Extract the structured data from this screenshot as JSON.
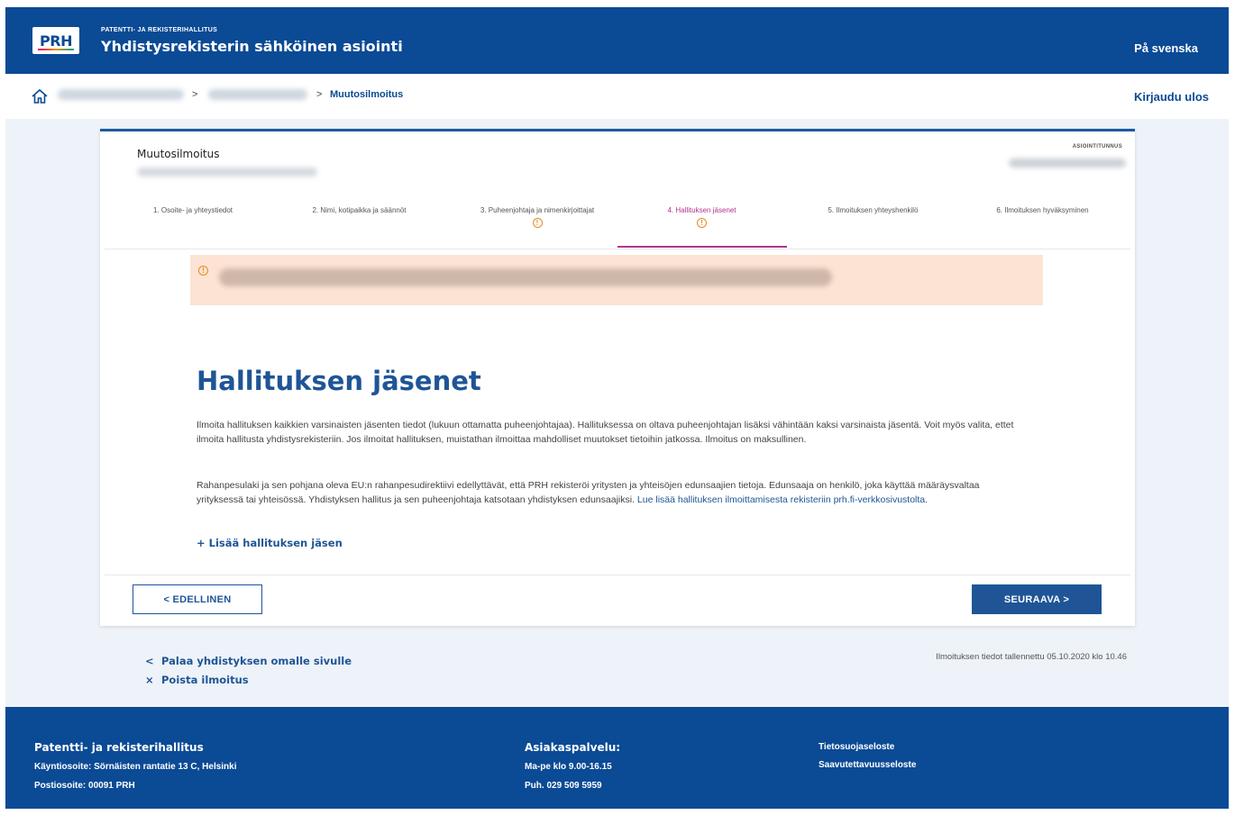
{
  "header": {
    "logo_text": "PRH",
    "org_small": "PATENTTI- JA REKISTERIHALLITUS",
    "app_title": "Yhdistysrekisterin sähköinen asiointi",
    "language_link": "På svenska"
  },
  "breadcrumb": {
    "separator": ">",
    "current": "Muutosilmoitus",
    "logout": "Kirjaudu ulos"
  },
  "card": {
    "title": "Muutosilmoitus",
    "id_label": "ASIOINTITUNNUS",
    "steps": [
      {
        "label": "1. Osoite- ja yhteystiedot",
        "warning": false,
        "active": false
      },
      {
        "label": "2. Nimi, kotipaikka ja säännöt",
        "warning": false,
        "active": false
      },
      {
        "label": "3. Puheenjohtaja ja nimenkirjoittajat",
        "warning": true,
        "active": false
      },
      {
        "label": "4. Hallituksen jäsenet",
        "warning": true,
        "active": true
      },
      {
        "label": "5. Ilmoituksen yhteyshenkilö",
        "warning": false,
        "active": false
      },
      {
        "label": "6. Ilmoituksen hyväksyminen",
        "warning": false,
        "active": false
      }
    ],
    "warning_symbol": "!",
    "heading": "Hallituksen jäsenet",
    "para1": "Ilmoita hallituksen kaikkien varsinaisten jäsenten tiedot (lukuun ottamatta puheenjohtajaa). Hallituksessa on oltava puheenjohtajan lisäksi vähintään kaksi varsinaista jäsentä. Voit myös valita, ettet ilmoita hallitusta yhdistysrekisteriin. Jos ilmoitat hallituksen, muistathan ilmoittaa mahdolliset muutokset tietoihin jatkossa. Ilmoitus on maksullinen.",
    "para2_text": "Rahanpesulaki ja sen pohjana oleva EU:n rahanpesudirektiivi edellyttävät, että PRH rekisteröi yritysten ja yhteisöjen edunsaajien tietoja. Edunsaaja on henkilö, joka käyttää määräysvaltaa yrityksessä tai yhteisössä. Yhdistyksen hallitus ja sen puheenjohtaja katsotaan yhdistyksen edunsaajiksi.",
    "para2_link": "Lue lisää hallituksen ilmoittamisesta rekisteriin prh.fi-verkkosivustolta.",
    "add_member": "+ Lisää hallituksen jäsen",
    "prev_button": "< EDELLINEN",
    "next_button": "SEURAAVA >"
  },
  "below": {
    "back_link_symbol": "<",
    "back_link": "Palaa yhdistyksen omalle sivulle",
    "delete_link_symbol": "×",
    "delete_link": "Poista ilmoitus",
    "saved_note": "Ilmoituksen tiedot tallennettu 05.10.2020 klo 10.46"
  },
  "footer": {
    "org_name": "Patentti- ja rekisterihallitus",
    "visit_address": "Käyntiosoite: Sörnäisten rantatie 13 C, Helsinki",
    "postal_address": "Postiosoite: 00091 PRH",
    "service_title": "Asiakaspalvelu:",
    "service_hours": "Ma-pe klo 9.00-16.15",
    "service_phone": "Puh. 029 509 5959",
    "privacy_link": "Tietosuojaseloste",
    "accessibility_link": "Saavutettavuusseloste"
  },
  "colors": {
    "brand_blue": "#0b4a95",
    "link_blue": "#1f5596",
    "active_step": "#b5318c",
    "alert_bg": "#fde3d4",
    "warning": "#e58b1d"
  }
}
